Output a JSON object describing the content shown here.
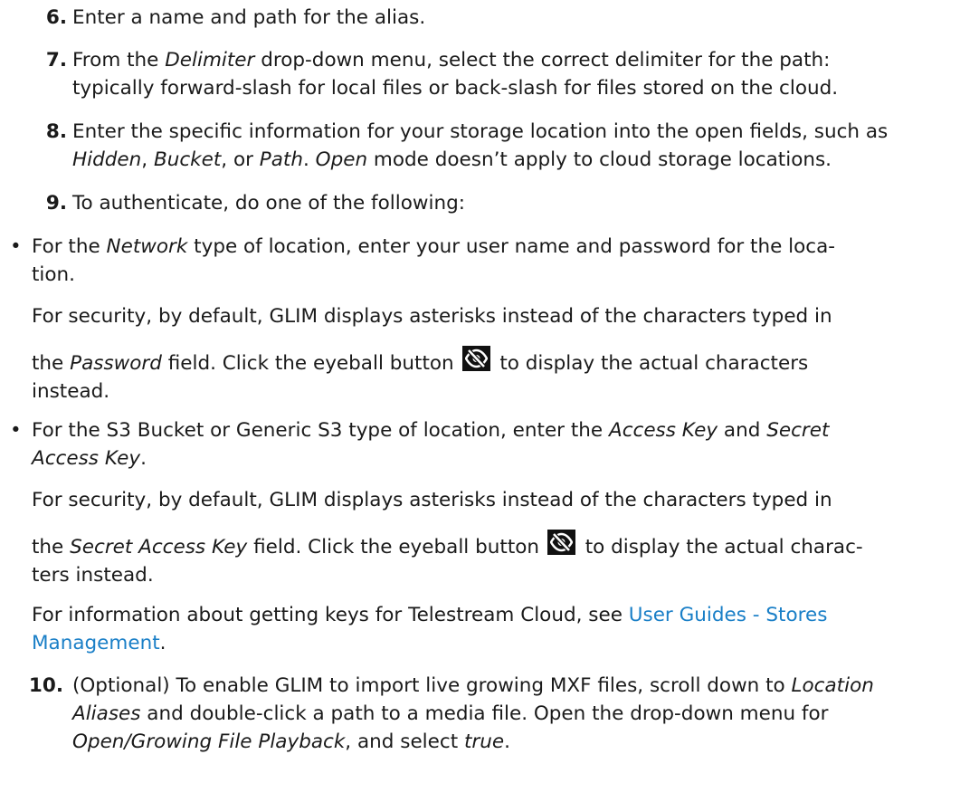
{
  "steps": [
    {
      "num": "6.",
      "a": "Enter a name and path for the alias."
    },
    {
      "num": "7.",
      "a": "From the ",
      "b": "Delimiter",
      "c": " drop-down menu, select the correct delimiter for the path:",
      "d": "typically forward-slash for local files or back-slash for files stored on the cloud."
    },
    {
      "num": "8.",
      "a": "Enter the specific information for your storage location into the open fields, such as",
      "b": "Hidden",
      "c": ", ",
      "d": "Bucket",
      "e": ", or ",
      "f": "Path",
      "g": ". ",
      "h": "Open",
      "i": " mode doesn’t apply to cloud storage locations."
    },
    {
      "num": "9.",
      "a": "To authenticate, do one of the following:"
    },
    {
      "num": "10.",
      "a": "(Optional) To enable GLIM to import live growing MXF files, scroll down to ",
      "b": "Location",
      "c": "Aliases",
      "d": " and double-click a path to a media file. Open the drop-down menu for",
      "e": "Open/Growing File Playback",
      "f": ", and select ",
      "g": "true",
      "h": "."
    }
  ],
  "bullets": [
    {
      "bullet": "•",
      "l1a": "For the ",
      "l1b": "Network",
      "l1c": " type of location, enter your user name and password for the loca-",
      "l2": "tion.",
      "p1": "For security, by default, GLIM displays asterisks instead of the characters typed in",
      "p2a": "the ",
      "p2b": "Password",
      "p2c": " field. Click the eyeball button ",
      "p2d": " to display the actual characters",
      "p3": "instead."
    },
    {
      "bullet": "•",
      "l1a": "For the S3 Bucket or Generic S3 type of location, enter the ",
      "l1b": "Access Key",
      "l1c": " and ",
      "l1d": "Secret",
      "l2a": "Access Key",
      "l2b": ".",
      "p1": "For security, by default, GLIM displays asterisks instead of the characters typed in",
      "p2a": "the ",
      "p2b": "Secret Access Key",
      "p2c": " field. Click the eyeball button ",
      "p2d": " to display the actual charac-",
      "p3": "ters instead.",
      "p4": "For information about getting keys for Telestream Cloud, see ",
      "link1": "User Guides - Stores",
      "link2": "Management",
      "p4end": "."
    }
  ],
  "icons": {
    "eyeball": "eye-slash-icon"
  }
}
